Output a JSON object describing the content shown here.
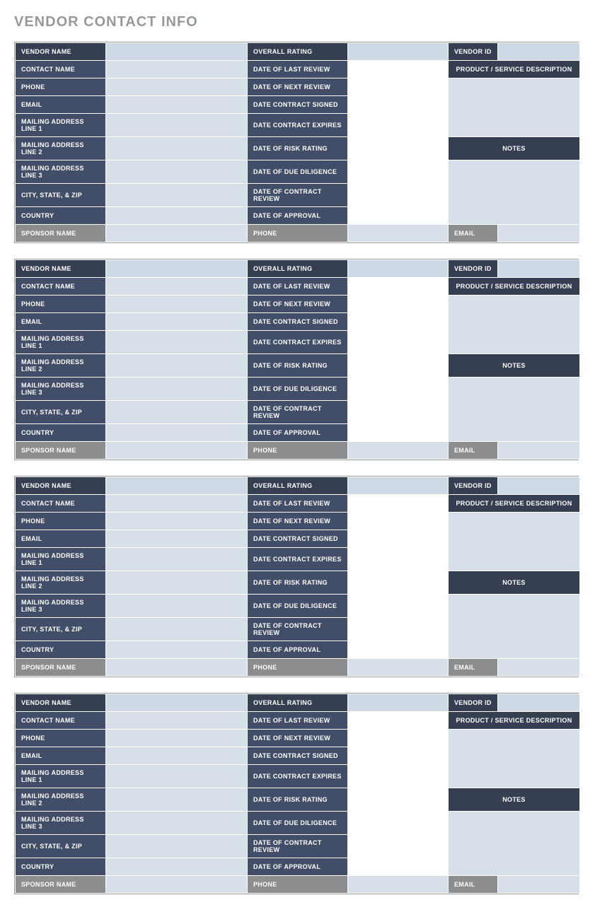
{
  "title": "VENDOR CONTACT INFO",
  "labels": {
    "vendor_name": "VENDOR NAME",
    "overall_rating": "OVERALL RATING",
    "vendor_id": "VENDOR ID",
    "contact_name": "CONTACT NAME",
    "date_last_review": "DATE OF LAST REVIEW",
    "product_desc": "PRODUCT / SERVICE DESCRIPTION",
    "phone": "PHONE",
    "date_next_review": "DATE OF NEXT REVIEW",
    "email": "EMAIL",
    "date_contract_signed": "DATE CONTRACT SIGNED",
    "mailing1": "MAILING ADDRESS LINE 1",
    "date_contract_expires": "DATE CONTRACT EXPIRES",
    "mailing2": "MAILING ADDRESS LINE 2",
    "date_risk_rating": "DATE OF RISK RATING",
    "notes": "NOTES",
    "mailing3": "MAILING ADDRESS LINE 3",
    "date_due_diligence": "DATE OF DUE DILIGENCE",
    "city_state_zip": "CITY, STATE, & ZIP",
    "date_contract_review": "DATE OF CONTRACT REVIEW",
    "country": "COUNTRY",
    "date_approval": "DATE OF APPROVAL",
    "sponsor_name": "SPONSOR NAME",
    "sponsor_phone": "PHONE",
    "sponsor_email": "EMAIL"
  },
  "vendors": [
    {
      "vendor_name": "",
      "overall_rating": "",
      "vendor_id": "",
      "contact_name": "",
      "date_last_review": "",
      "product_desc": "",
      "phone": "",
      "date_next_review": "",
      "email": "",
      "date_contract_signed": "",
      "mailing1": "",
      "date_contract_expires": "",
      "mailing2": "",
      "date_risk_rating": "",
      "notes": "",
      "mailing3": "",
      "date_due_diligence": "",
      "city_state_zip": "",
      "date_contract_review": "",
      "country": "",
      "date_approval": "",
      "sponsor_name": "",
      "sponsor_phone": "",
      "sponsor_email": ""
    },
    {
      "vendor_name": "",
      "overall_rating": "",
      "vendor_id": "",
      "contact_name": "",
      "date_last_review": "",
      "product_desc": "",
      "phone": "",
      "date_next_review": "",
      "email": "",
      "date_contract_signed": "",
      "mailing1": "",
      "date_contract_expires": "",
      "mailing2": "",
      "date_risk_rating": "",
      "notes": "",
      "mailing3": "",
      "date_due_diligence": "",
      "city_state_zip": "",
      "date_contract_review": "",
      "country": "",
      "date_approval": "",
      "sponsor_name": "",
      "sponsor_phone": "",
      "sponsor_email": ""
    },
    {
      "vendor_name": "",
      "overall_rating": "",
      "vendor_id": "",
      "contact_name": "",
      "date_last_review": "",
      "product_desc": "",
      "phone": "",
      "date_next_review": "",
      "email": "",
      "date_contract_signed": "",
      "mailing1": "",
      "date_contract_expires": "",
      "mailing2": "",
      "date_risk_rating": "",
      "notes": "",
      "mailing3": "",
      "date_due_diligence": "",
      "city_state_zip": "",
      "date_contract_review": "",
      "country": "",
      "date_approval": "",
      "sponsor_name": "",
      "sponsor_phone": "",
      "sponsor_email": ""
    },
    {
      "vendor_name": "",
      "overall_rating": "",
      "vendor_id": "",
      "contact_name": "",
      "date_last_review": "",
      "product_desc": "",
      "phone": "",
      "date_next_review": "",
      "email": "",
      "date_contract_signed": "",
      "mailing1": "",
      "date_contract_expires": "",
      "mailing2": "",
      "date_risk_rating": "",
      "notes": "",
      "mailing3": "",
      "date_due_diligence": "",
      "city_state_zip": "",
      "date_contract_review": "",
      "country": "",
      "date_approval": "",
      "sponsor_name": "",
      "sponsor_phone": "",
      "sponsor_email": ""
    }
  ]
}
